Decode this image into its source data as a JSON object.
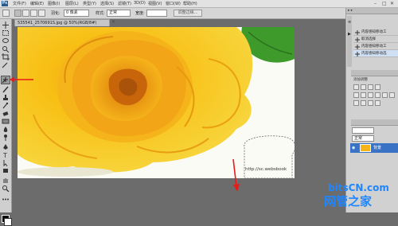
{
  "menubar": {
    "items": [
      "文件(F)",
      "编辑(E)",
      "图像(I)",
      "图层(L)",
      "类型(Y)",
      "选择(S)",
      "滤镜(T)",
      "3D(D)",
      "视图(V)",
      "窗口(W)",
      "帮助(H)"
    ]
  },
  "options": {
    "feather_label": "羽化:",
    "feather_value": "0 像素",
    "style_label": "样式:",
    "style_value": "正常",
    "width_label": "宽度:",
    "adjust_edge_button": "调整边缘..."
  },
  "document": {
    "tab_title": "535541_2570691S.jpg @ 50%(RGB/8#)",
    "url_text": "http://sc.websbook"
  },
  "panels": {
    "history_items": [
      "内容感知移动工",
      "取消选择",
      "内容感知移动工",
      "内容感知移动选"
    ],
    "adjustments_title": "添加调整",
    "layers_blend_mode": "正常",
    "layer_name": "背景"
  },
  "watermark": {
    "line1": "bitsCN.com",
    "line2": "网管之家"
  },
  "colors": {
    "accent_blue": "#1e86ff",
    "annotation_red": "#e81b1b",
    "rose_yellow": "#f6c000"
  }
}
